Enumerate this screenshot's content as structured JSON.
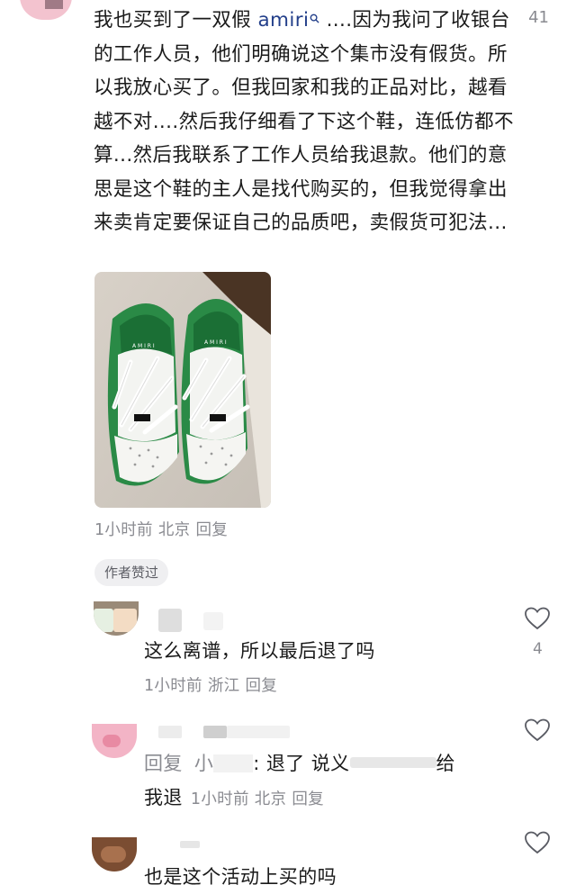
{
  "top_comment": {
    "text_prefix": "我也买到了一双假 ",
    "brand": "amiri",
    "text_rest": " ....因为我问了收银台的工作人员，他们明确说这个集市没有假货。所以我放心买了。但我回家和我的正品对比，越看越不对....然后我仔细看了下这个鞋，连低仿都不算...然后我联系了工作人员给我退款。他们的意思是这个鞋的主人是找代购买的，但我觉得拿出来卖肯定要保证自己的品质吧，卖假货可犯法...",
    "like_count": "41",
    "time": "1小时前",
    "location": "北京",
    "reply_label": "回复",
    "author_liked_badge": "作者赞过",
    "icons": {
      "search": "search-icon"
    }
  },
  "replies": [
    {
      "text": "这么离谱，所以最后退了吗",
      "time": "1小时前",
      "location": "浙江",
      "reply_label": "回复",
      "like_count": "4"
    },
    {
      "prefix": "回复",
      "mention": "小",
      "text_a": ": 退了 说义",
      "text_b": "给",
      "text_c": "我退",
      "time": "1小时前",
      "location": "北京",
      "reply_label": "回复",
      "like_count": ""
    },
    {
      "text": "也是这个活动上买的吗",
      "like_count": ""
    }
  ]
}
